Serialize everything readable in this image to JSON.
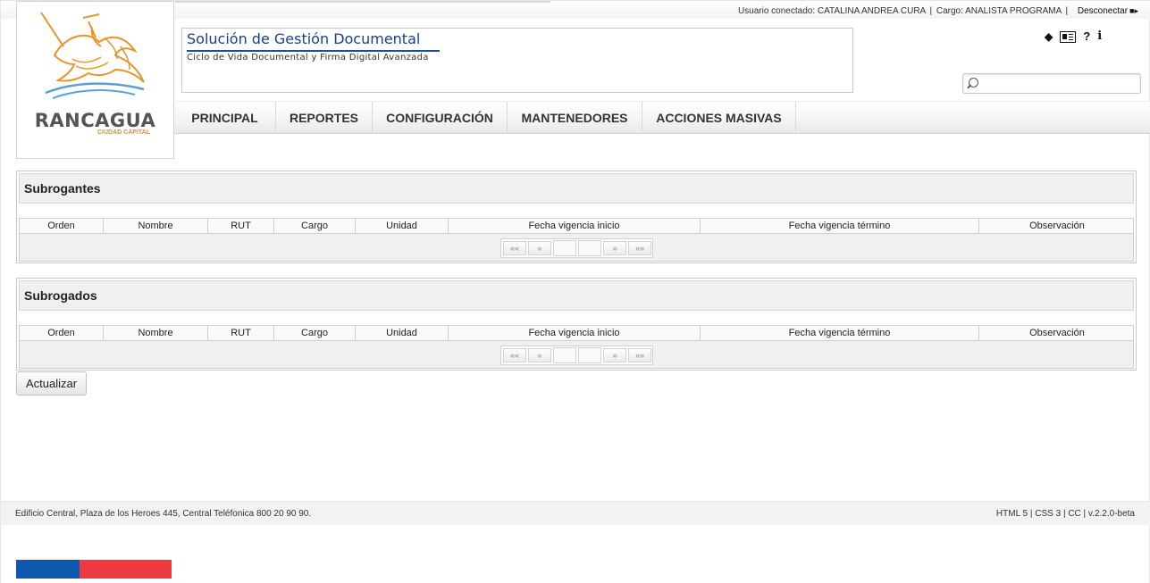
{
  "header": {
    "user_label": "Usuario conectado:",
    "user_name": "CATALINA ANDREA CURA",
    "sep1": "|",
    "role_label": "Cargo:",
    "role_name": "ANALISTA PROGRAMA",
    "sep2": "|",
    "logout": "Desconectar",
    "logout_icon": "logout-icon"
  },
  "logo": {
    "name": "RANCAGUA",
    "subtitle": "CIUDAD CAPITAL",
    "colors": {
      "orange": "#e8952a",
      "blue": "#5b9fd6"
    }
  },
  "app": {
    "title": "Solución de Gestión Documental",
    "subtitle": "Ciclo de Vida Documental y Firma Digital Avanzada"
  },
  "tools": {
    "book": "▮",
    "help": "?",
    "info": "i"
  },
  "search": {
    "value": "",
    "placeholder": ""
  },
  "nav": [
    {
      "label": "PRINCIPAL"
    },
    {
      "label": "REPORTES"
    },
    {
      "label": "CONFIGURACIÓN"
    },
    {
      "label": "MANTENEDORES"
    },
    {
      "label": "ACCIONES MASIVAS"
    }
  ],
  "columns": [
    "Orden",
    "Nombre",
    "RUT",
    "Cargo",
    "Unidad",
    "Fecha vigencia inicio",
    "Fecha vigencia término",
    "Observación"
  ],
  "pager": {
    "first": "««",
    "prev": "«",
    "next": "»",
    "last": "»»"
  },
  "panels": [
    {
      "title": "Subrogantes"
    },
    {
      "title": "Subrogados"
    }
  ],
  "actions": {
    "update": "Actualizar"
  },
  "footer": {
    "address": "Edificio Central, Plaza de los Heroes 445, Central Teléfonica 800 20 90 90.",
    "tech": "HTML 5 | CSS 3 | CC | v.2.2.0-beta"
  },
  "colors": {
    "flag_blue": "#0e58b0",
    "flag_red": "#ee3b43",
    "title_blue": "#1a3f8c"
  }
}
